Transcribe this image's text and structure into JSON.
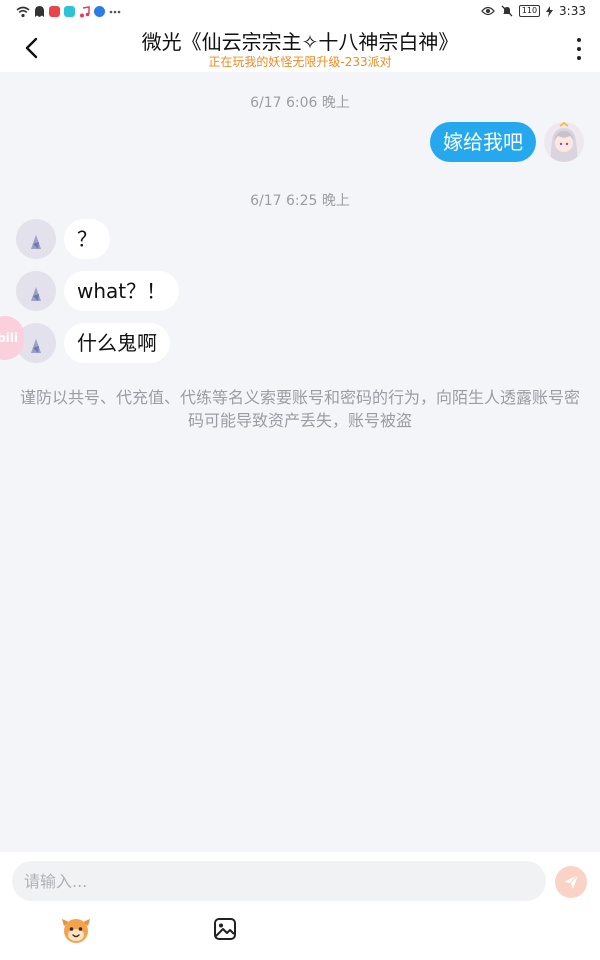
{
  "status_bar": {
    "time": "3:33",
    "battery": "110",
    "icons": [
      "wifi-icon",
      "ghost-icon",
      "app-red-icon",
      "app-teal-icon",
      "music-icon",
      "app-blue-icon",
      "more-dots-icon",
      "eye-icon",
      "mute-icon",
      "battery-icon",
      "charging-icon"
    ]
  },
  "header": {
    "title": "微光《仙云宗宗主✧十八神宗白神》",
    "subtitle": "正在玩我的妖怪无限升级-233派对",
    "back_icon": "chevron-left-icon",
    "more_icon": "more-vertical-icon"
  },
  "chat": {
    "timestamp_1": "6/17 6:06 晚上",
    "outgoing_message": "嫁给我吧",
    "timestamp_2": "6/17 6:25 晚上",
    "incoming_messages": [
      "？",
      "what？！",
      "什么鬼啊"
    ],
    "floating_badge": "bili",
    "warning": "谨防以共号、代充值、代练等名义索要账号和密码的行为，向陌生人透露账号密码可能导致资产丢失，账号被盗"
  },
  "composer": {
    "placeholder": "请输入...",
    "send_icon": "send-icon",
    "emoji_icon": "emoji-face-icon",
    "image_icon": "image-icon"
  },
  "colors": {
    "accent_blue": "#26a8ee",
    "subtitle_orange": "#f08a24",
    "timestamp_gray": "#9c9ca4",
    "send_disabled": "#fbd2c6"
  }
}
